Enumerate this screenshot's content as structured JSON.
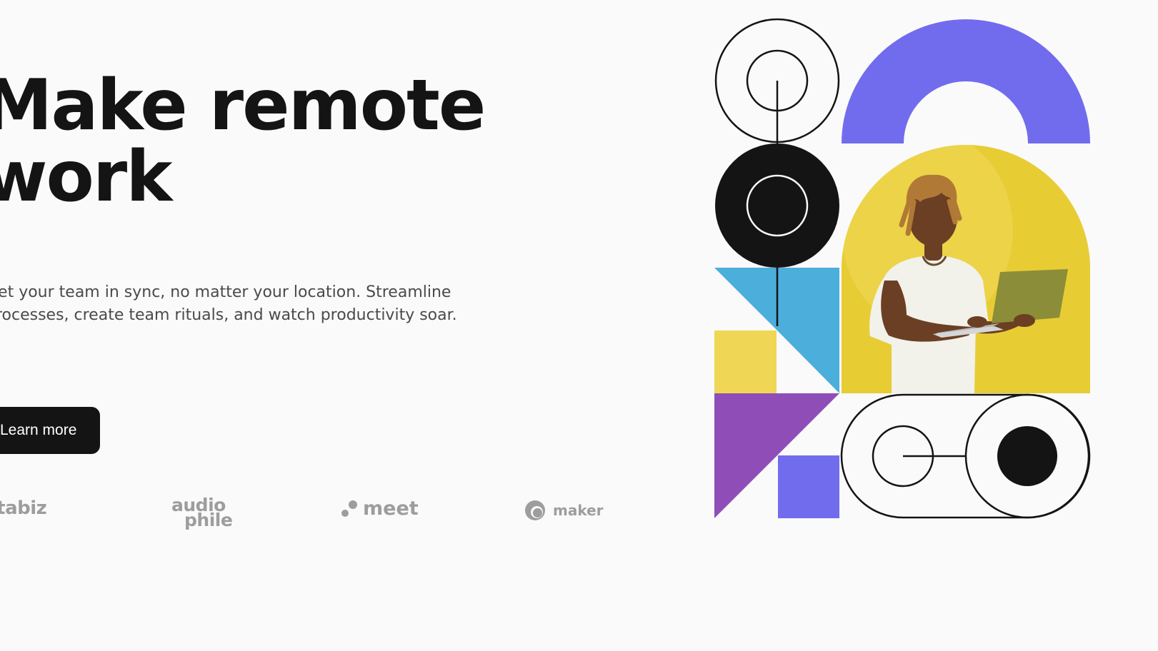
{
  "hero": {
    "title_line1": "Make remote",
    "title_line2": "work",
    "description_line1": "Get your team in sync, no matter your location. Streamline",
    "description_line2": "processes, create team rituals, and watch productivity soar.",
    "cta_label": "Learn more"
  },
  "clients": {
    "databiz": "databiz",
    "audiophile_line1": "audio",
    "audiophile_line2": "phile",
    "meet": "meet",
    "maker": "maker"
  },
  "colors": {
    "background": "#fafafa",
    "text": "#141414",
    "muted": "#9d9d9d",
    "purple": "#716cee",
    "yellow": "#e7cc34",
    "light_yellow": "#efd755",
    "blue": "#4caedb",
    "violet": "#8f4db8"
  }
}
